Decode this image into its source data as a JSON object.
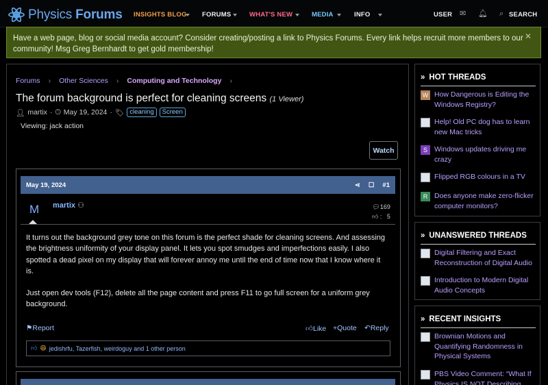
{
  "brand": {
    "name_a": "Physics ",
    "name_b": "Forums",
    "color": "#6aa8ec"
  },
  "nav": {
    "items": [
      {
        "label": "INSIGHTS BLOG",
        "color": "#f0a04a"
      },
      {
        "label": "FORUMS",
        "color": "#f0f0f0"
      },
      {
        "label": "WHAT'S NEW",
        "color": "#ff6a8a"
      },
      {
        "label": "MEDIA",
        "color": "#78c8ff"
      },
      {
        "label": "INFO",
        "color": "#f0f0f0"
      }
    ],
    "user": "USER",
    "search": "SEARCH"
  },
  "banner": {
    "text": "Have a web page, blog or social media account? Consider creating/posting a link to Physics Forums. Every link helps recruit more members to our community! Msg Greg Bernhardt to get gold membership!",
    "close": "✕"
  },
  "breadcrumb": [
    "Forums",
    "Other Sciences",
    "Computing and Technology"
  ],
  "thread": {
    "title": "The forum background is perfect for cleaning screens",
    "viewers": "(1 Viewer)",
    "author": "martix",
    "date": "May 19, 2024",
    "tags": [
      "cleaning",
      "Screen"
    ],
    "viewing": "Viewing: jack action",
    "watch": "Watch"
  },
  "post": {
    "date": "May 19, 2024",
    "number": "#1",
    "avatar_letter": "M",
    "author": "martix",
    "messages": "169",
    "reactions": "5",
    "body": [
      "It turns out the background grey tone on this forum is the perfect shade for cleaning screens. And assessing the brightness uniformity of your display panel. It lets you spot smudges and imperfections easily. I also spotted a dead pixel on my display that will forever annoy me until the end of time now that I know where it is.",
      "Just open dev tools (F12), delete all the page content and press F11 to go full screen for a uniform grey background."
    ],
    "report": "Report",
    "like": "Like",
    "quote": "Quote",
    "reply": "Reply",
    "likes_text": "jedishrfu, Tazerfish, weirdoguy and 1 other person"
  },
  "sidebar": {
    "hot": {
      "title": "HOT THREADS",
      "items": [
        {
          "icon": "W",
          "color": "#b5855a",
          "label": "How Dangerous is Editing the Windows Registry?"
        },
        {
          "icon": "",
          "color": "",
          "label": "Help! Old PC dog has to learn new Mac tricks"
        },
        {
          "icon": "S",
          "color": "#7a3fb8",
          "label": "Windows updates driving me crazy"
        },
        {
          "icon": "",
          "color": "",
          "label": "Flipped RGB colours in a TV"
        },
        {
          "icon": "R",
          "color": "#3a8a5a",
          "label": "Does anyone make zero-flicker computer monitors?"
        }
      ]
    },
    "unanswered": {
      "title": "UNANSWERED THREADS",
      "items": [
        {
          "label": "Digital Filtering and Exact Reconstruction of Digital Audio"
        },
        {
          "label": "Introduction to Modern Digital Audio Concepts"
        }
      ]
    },
    "insights": {
      "title": "RECENT INSIGHTS",
      "items": [
        {
          "label": "Brownian Motions and Quantifying Randomness in Physical Systems"
        },
        {
          "label": "PBS Video Comment: “What If Physics IS NOT Describing"
        }
      ]
    }
  }
}
